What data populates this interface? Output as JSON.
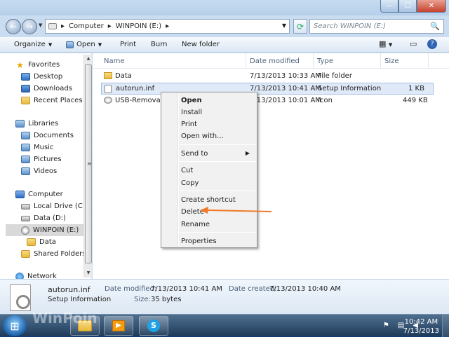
{
  "window": {
    "controls": {
      "minimize": "—",
      "maximize": "☐",
      "close": "✕"
    }
  },
  "navbar": {
    "back": "←",
    "forward": "→",
    "breadcrumb": [
      "Computer",
      "WINPOIN (E:)"
    ],
    "separator": "▸",
    "search_placeholder": "Search WINPOIN (E:)"
  },
  "toolbar": {
    "organize": "Organize",
    "open": "Open",
    "print": "Print",
    "burn": "Burn",
    "new_folder": "New folder"
  },
  "sidebar": {
    "favorites": {
      "label": "Favorites",
      "items": [
        "Desktop",
        "Downloads",
        "Recent Places"
      ]
    },
    "libraries": {
      "label": "Libraries",
      "items": [
        "Documents",
        "Music",
        "Pictures",
        "Videos"
      ]
    },
    "computer": {
      "label": "Computer",
      "items": [
        "Local Drive (C:)",
        "Data (D:)",
        "WINPOIN (E:)",
        "Data",
        "Shared Folders (\\"
      ]
    },
    "network": {
      "label": "Network"
    }
  },
  "columns": {
    "name": "Name",
    "date": "Date modified",
    "type": "Type",
    "size": "Size"
  },
  "files": [
    {
      "name": "Data",
      "date": "7/13/2013 10:33 AM",
      "type": "File folder",
      "size": ""
    },
    {
      "name": "autorun.inf",
      "date": "7/13/2013 10:41 AM",
      "type": "Setup Information",
      "size": "1 KB"
    },
    {
      "name": "USB-Removabl",
      "date": "7/13/2013 10:01 AM",
      "type": "Icon",
      "size": "449 KB"
    }
  ],
  "context_menu": {
    "open": "Open",
    "install": "Install",
    "print": "Print",
    "open_with": "Open with...",
    "send_to": "Send to",
    "cut": "Cut",
    "copy": "Copy",
    "create_shortcut": "Create shortcut",
    "delete": "Delete",
    "rename": "Rename",
    "properties": "Properties"
  },
  "details": {
    "name": "autorun.inf",
    "type": "Setup Information",
    "modified_label": "Date modified:",
    "modified": "7/13/2013 10:41 AM",
    "size_label": "Size:",
    "size": "35 bytes",
    "created_label": "Date created:",
    "created": "7/13/2013 10:40 AM"
  },
  "taskbar": {
    "watermark": "WinPoin",
    "time": "10:42 AM",
    "date": "7/13/2013"
  },
  "colors": {
    "annotation_arrow": "#f07a2a",
    "selection": "#dfe9f7"
  }
}
